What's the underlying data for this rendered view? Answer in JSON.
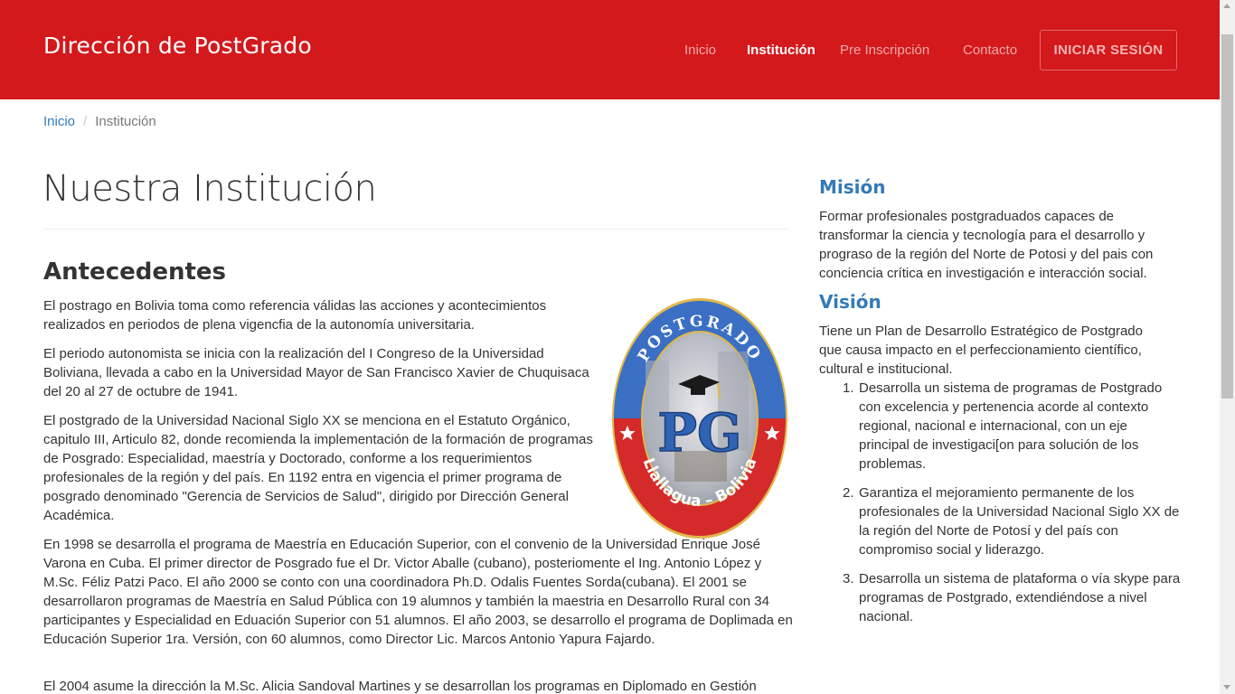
{
  "navbar": {
    "brand": "Dirección de PostGrado",
    "links": [
      "Inicio",
      "Institución",
      "Pre Inscripción",
      "Contacto"
    ],
    "active": "Institución",
    "login_label": "INICIAR SESIÓN"
  },
  "breadcrumb": {
    "home": "Inicio",
    "separator": "/",
    "current": "Institución"
  },
  "main": {
    "title": "Nuestra Institución",
    "section_title": "Antecedentes",
    "paragraphs": [
      "El postrago en Bolivia toma como referencia válidas las acciones y acontecimientos realizados en periodos de plena vigencfia de la autonomía universitaria.",
      "El periodo autonomista se inicia con la realización del I Congreso de la Universidad Boliviana, llevada a cabo en la Universidad Mayor de San Francisco Xavier de Chuquisaca del 20 al 27 de octubre de 1941.",
      "El postgrado de la Universidad Nacional Siglo XX se menciona en el Estatuto Orgánico, capitulo III, Articulo 82, donde recomienda la implementación de la formación de programas de Posgrado: Especialidad, maestría y Doctorado, conforme a los requerimientos profesionales de la región y del país. En 1192 entra en vigencia el primer programa de posgrado denominado \"Gerencia de Servicios de Salud\", dirigido por Dirección General Académica.",
      "En 1998 se desarrolla el programa de Maestría en Educación Superior, con el convenio de la Universidad Enrique José Varona en Cuba. El primer director de Posgrado fue el Dr. Victor Aballe (cubano), posteriomente el Ing. Antonio López y M.Sc. Féliz Patzi Paco. El año 2000 se conto con una coordinadora Ph.D. Odalis Fuentes Sorda(cubana). El 2001 se desarrollaron programas de Maestría en Salud Pública con 19 alumnos y también la maestria en Desarrollo Rural con 34 participantes y Especialidad en Eduación Superior con 51 alumnos. El año 2003, se desarrollo el programa de Doplimada en Educación Superior 1ra. Versión, con 60 alumnos, como Director Lic. Marcos Antonio Yapura Fajardo.",
      "El 2004 asume la dirección la M.Sc. Alicia Sandoval Martines y se desarrollan los programas en Diplomado en Gestión"
    ],
    "logo": {
      "top_text": "POSTGRADO",
      "letters": "PG",
      "bottom_text": "Llallagua – Bolivia",
      "colors": {
        "blue": "#3a6fc4",
        "red": "#d42a2a",
        "gold": "#e0b84a"
      }
    }
  },
  "sidebar": {
    "mision_title": "Misión",
    "mision_text": "Formar profesionales postgraduados capaces de transformar la ciencia y tecnología para el desarrollo y prograso de la región del Norte de Potosi y del pais con conciencia crítica en investigación e interacción social.",
    "vision_title": "Visión",
    "vision_text": "Tiene un Plan de Desarrollo Estratégico de Postgrado que causa impacto en el perfeccionamiento científico, cultural e institucional.",
    "vision_items": [
      "Desarrolla un sistema de programas de Postgrado con excelencia y pertenencia acorde al contexto regional, nacional e internacional, con un eje principal de investigaci[on para solución de los problemas.",
      "Garantiza el mejoramiento permanente de los profesionales de la Universidad Nacional Siglo XX de la región del Norte de Potosí y del país con compromiso social y liderazgo.",
      "Desarrolla un sistema de plataforma o vía skype para programas de Postgrado, extendiéndose a nivel nacional."
    ]
  },
  "colors": {
    "navbar_bg": "#d3191c",
    "link": "#337ab7",
    "text": "#333333"
  }
}
